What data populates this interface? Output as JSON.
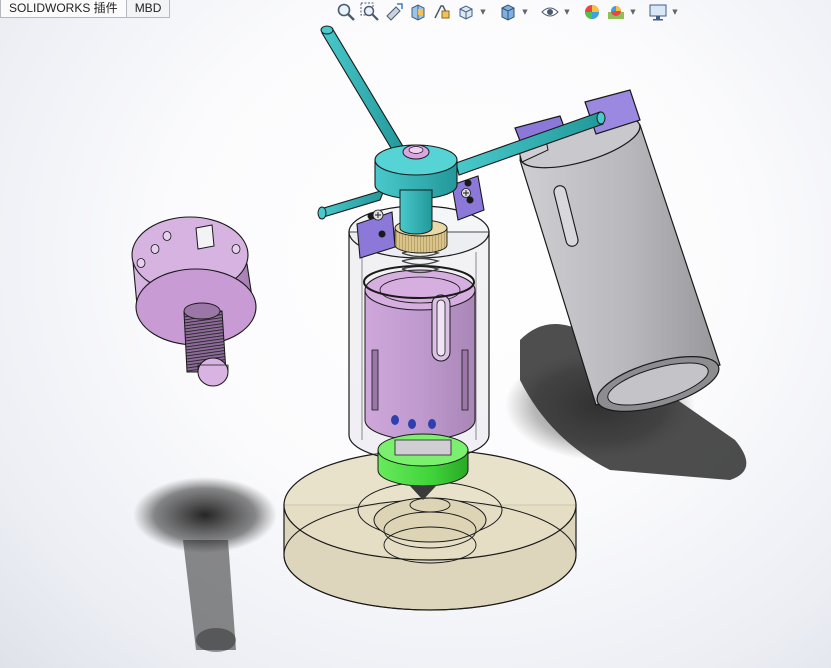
{
  "tabs": [
    {
      "label": "SOLIDWORKS 插件"
    },
    {
      "label": "MBD"
    }
  ],
  "toolbar": {
    "icons": [
      "zoom-to-fit-icon",
      "zoom-to-area-icon",
      "previous-view-icon",
      "section-view-icon",
      "dynamic-annotation-icon",
      "view-orientation-icon",
      "display-style-icon",
      "hide-show-items-icon",
      "edit-appearance-icon",
      "apply-scene-icon",
      "view-settings-icon"
    ]
  },
  "colors": {
    "handle": "#2fb5b7",
    "handle_dark": "#1c8587",
    "purple": "#c99cd6",
    "violet_block": "#8b78d8",
    "green_nozzle": "#3fd43a",
    "base_tan": "#e3dcc0",
    "gray_cylinder": "#b4b4b8",
    "brass": "#d6c28a"
  }
}
